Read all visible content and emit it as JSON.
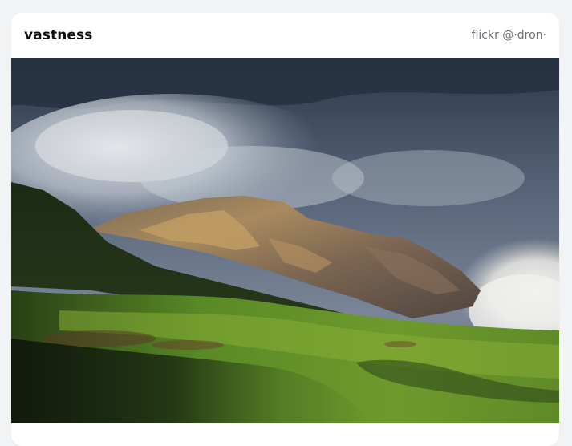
{
  "card": {
    "title": "vastness",
    "credit": "flickr @·dron·"
  },
  "photo": {
    "alt": "Mountain landscape under storm clouds with sunlit ridge and green meadow"
  }
}
